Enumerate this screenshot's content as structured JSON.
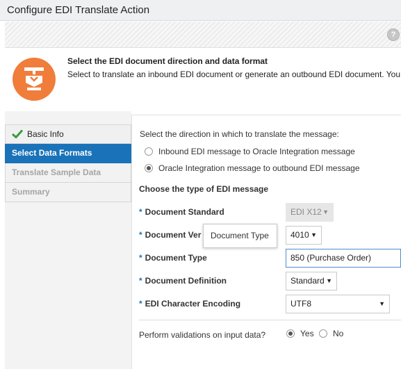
{
  "dialog": {
    "title": "Configure EDI Translate Action",
    "help_glyph": "?"
  },
  "header": {
    "icon": "edi-translate-icon",
    "title": "Select the EDI document direction and data format",
    "description": "Select to translate an inbound EDI document or generate an outbound EDI document. You"
  },
  "train": {
    "items": [
      {
        "label": "Basic Info",
        "state": "done",
        "icon": "check-icon"
      },
      {
        "label": "Select Data Formats",
        "state": "active"
      },
      {
        "label": "Translate Sample Data",
        "state": "disabled"
      },
      {
        "label": "Summary",
        "state": "disabled"
      }
    ]
  },
  "direction": {
    "prompt": "Select the direction in which to translate the message:",
    "options": [
      {
        "label": "Inbound EDI message to Oracle Integration message",
        "selected": false
      },
      {
        "label": "Oracle Integration message to outbound EDI message",
        "selected": true
      }
    ]
  },
  "message_type": {
    "heading": "Choose the type of EDI message",
    "required_marker": "*",
    "fields": {
      "document_standard": {
        "label": "Document Standard",
        "value": "EDI X12",
        "disabled": true
      },
      "document_version": {
        "label": "Document Ver",
        "value": "4010"
      },
      "document_type": {
        "label": "Document Type",
        "value": "850 (Purchase Order)"
      },
      "document_definition": {
        "label": "Document Definition",
        "value": "Standard"
      },
      "character_encoding": {
        "label": "EDI Character Encoding",
        "value": "UTF8"
      }
    },
    "dropdown_arrow": "▼"
  },
  "tooltip": {
    "text": "Document Type"
  },
  "validation": {
    "question": "Perform validations on input data?",
    "yes_label": "Yes",
    "no_label": "No",
    "selected": "Yes"
  },
  "colors": {
    "accent": "#1a73b8",
    "icon_bg": "#f07d3a",
    "check": "#3a9a3a"
  }
}
